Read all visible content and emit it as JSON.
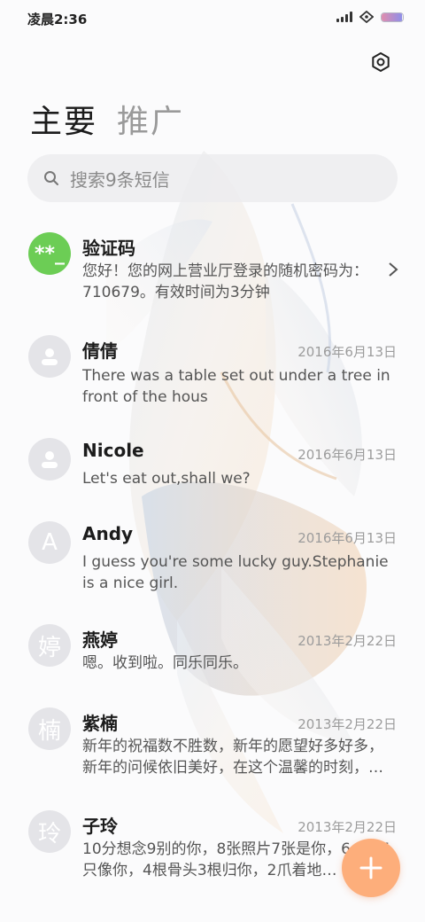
{
  "status_bar": {
    "time": "凌晨2:36",
    "battery_level": 0.95
  },
  "header": {
    "settings_icon": "gear-hexagon-icon",
    "tabs": [
      {
        "label": "主要",
        "active": true
      },
      {
        "label": "推广",
        "active": false
      }
    ]
  },
  "search": {
    "placeholder": "搜索9条短信",
    "icon": "search-icon"
  },
  "conversations": [
    {
      "avatar_text": "**_",
      "avatar_color": "#6ccd55",
      "name": "验证码",
      "date": "",
      "preview": "您好！您的网上营业厅登录的随机密码为：710679。有效时间为3分钟",
      "has_chevron": true
    },
    {
      "avatar_text": "",
      "avatar_icon": "person-icon",
      "name": "倩倩",
      "date": "2016年6月13日",
      "preview": "There was a table set out under a tree in front of the hous"
    },
    {
      "avatar_text": "",
      "avatar_icon": "person-icon",
      "name": "Nicole",
      "date": "2016年6月13日",
      "preview": "Let's eat out,shall we?"
    },
    {
      "avatar_text": "A",
      "name": "Andy",
      "date": "2016年6月13日",
      "preview": "I guess you're some lucky guy.Stephanie is a nice girl."
    },
    {
      "avatar_text": "婷",
      "name": "燕婷",
      "date": "2013年2月22日",
      "preview": "嗯。收到啦。同乐同乐。"
    },
    {
      "avatar_text": "楠",
      "name": "紫楠",
      "date": "2013年2月22日",
      "preview": "新年的祝福数不胜数，新年的愿望好多好多，新年的问候依旧美好，在这个温馨的时刻，…"
    },
    {
      "avatar_text": "玲",
      "name": "子玲",
      "date": "2013年2月22日",
      "preview": "10分想念9别的你，8张照片7张是你，6…狗5只像你，4根骨头3根归你，2爪着地…"
    }
  ],
  "fab": {
    "icon": "plus-icon",
    "color": "#fdae7b"
  }
}
